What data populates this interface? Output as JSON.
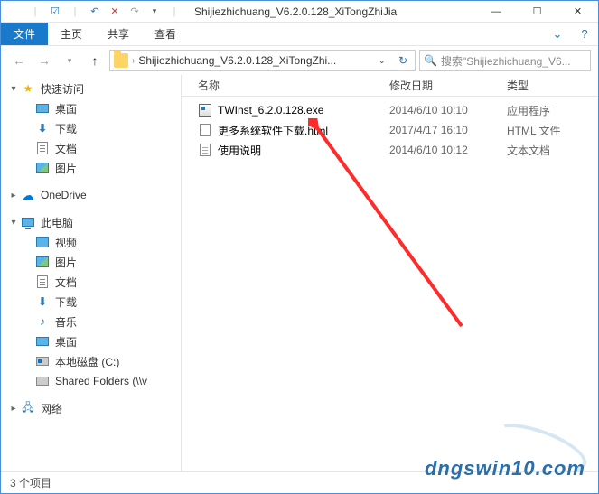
{
  "window": {
    "title": "Shijiezhichuang_V6.2.0.128_XiTongZhiJia"
  },
  "ribbon": {
    "file": "文件",
    "tabs": [
      "主页",
      "共享",
      "查看"
    ]
  },
  "nav": {
    "breadcrumb_text": "Shijiezhichuang_V6.2.0.128_XiTongZhi...",
    "search_placeholder": "搜索\"Shijiezhichuang_V6..."
  },
  "sidebar": {
    "quick_access": "快速访问",
    "qa_items": [
      "桌面",
      "下载",
      "文档",
      "图片"
    ],
    "onedrive": "OneDrive",
    "this_pc": "此电脑",
    "pc_items": [
      "视频",
      "图片",
      "文档",
      "下载",
      "音乐",
      "桌面",
      "本地磁盘 (C:)",
      "Shared Folders (\\\\v"
    ],
    "network": "网络"
  },
  "columns": {
    "name": "名称",
    "date": "修改日期",
    "type": "类型"
  },
  "files": [
    {
      "name": "TWInst_6.2.0.128.exe",
      "date": "2014/6/10 10:10",
      "type": "应用程序",
      "icon": "exe"
    },
    {
      "name": "更多系统软件下载.html",
      "date": "2017/4/17 16:10",
      "type": "HTML 文件",
      "icon": "html"
    },
    {
      "name": "使用说明",
      "date": "2014/6/10 10:12",
      "type": "文本文档",
      "icon": "txt"
    }
  ],
  "status": {
    "text": "3 个项目"
  },
  "watermark": "dngswin10.com"
}
